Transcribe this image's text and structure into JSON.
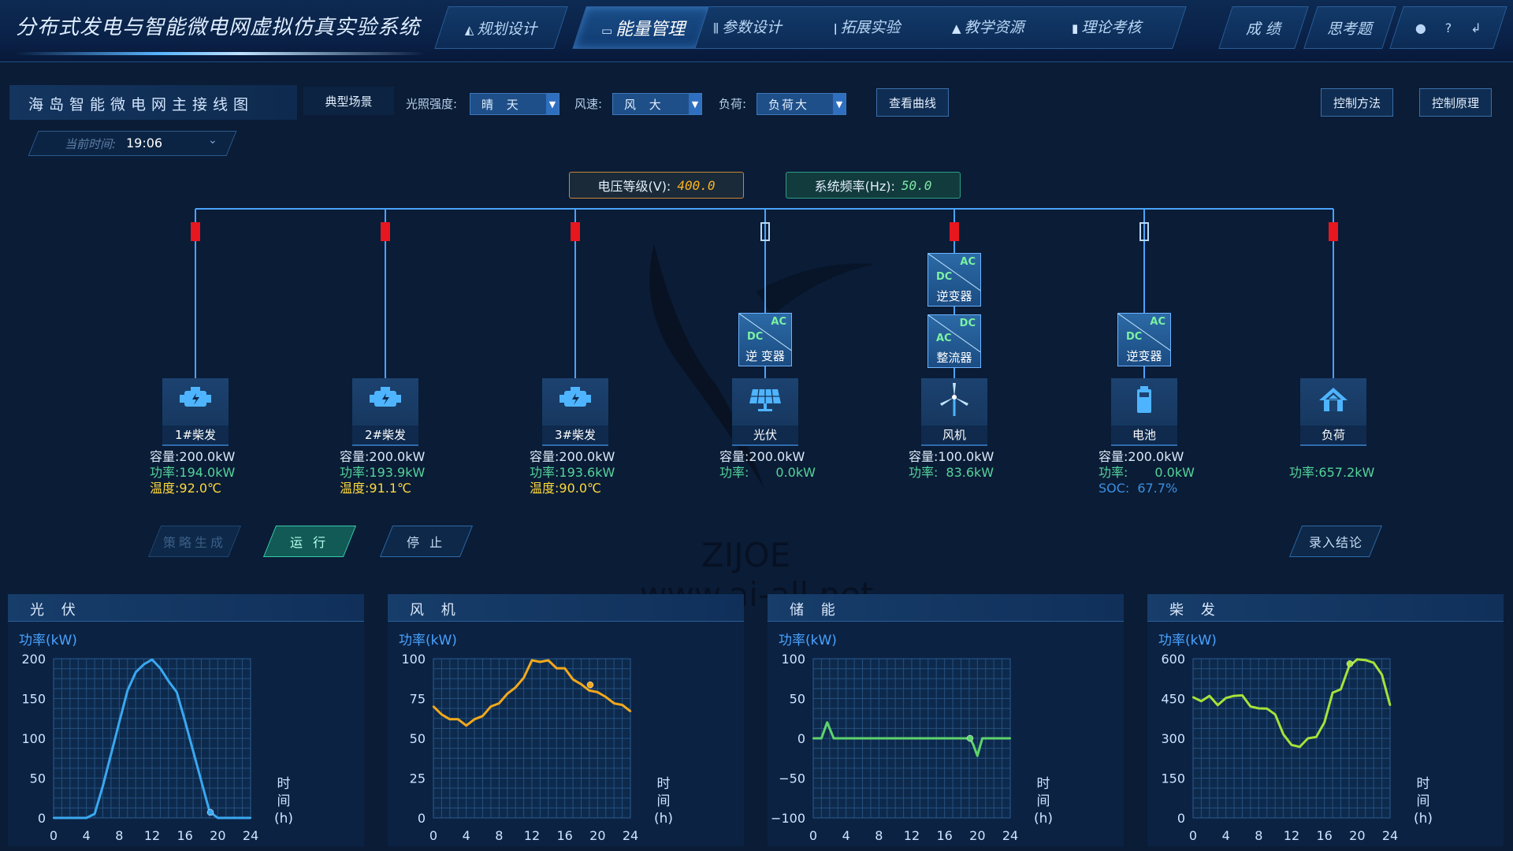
{
  "app": {
    "title": "分布式发电与智能微电网虚拟仿真实验系统"
  },
  "nav": {
    "tabs": [
      {
        "label": "规划设计",
        "icon": "pencil-triangle-icon",
        "active": false
      },
      {
        "label": "能量管理",
        "icon": "monitor-chart-icon",
        "active": true
      },
      {
        "label": "参数设计",
        "icon": "sliders-icon",
        "active": false
      },
      {
        "label": "拓展实验",
        "icon": "test-tube-icon",
        "active": false
      },
      {
        "label": "教学资源",
        "icon": "graduation-cap-icon",
        "active": false
      },
      {
        "label": "理论考核",
        "icon": "bar-chart-icon",
        "active": false
      }
    ],
    "right": [
      {
        "label": "成 绩"
      },
      {
        "label": "思考题"
      }
    ],
    "icons": [
      "user-icon",
      "help-icon",
      "exit-icon"
    ],
    "icon_glyphs": {
      "user": "●",
      "help": "?",
      "exit": "↲"
    }
  },
  "toolbar": {
    "panel_title": "海岛智能微电网主接线图",
    "scenario_button": "典型场景",
    "light_label": "光照强度:",
    "light_value": "晴 天",
    "wind_label": "风速:",
    "wind_value": "风 大",
    "load_label": "负荷:",
    "load_value": "负荷大",
    "view_curve": "查看曲线",
    "control_method": "控制方法",
    "control_principle": "控制原理",
    "time_label": "当前时间:",
    "time_value": "19:06"
  },
  "readouts": {
    "voltage_label": "电压等级(V):",
    "voltage_value": "400.0",
    "freq_label": "系统频率(Hz):",
    "freq_value": "50.0"
  },
  "converters": {
    "inverter": "逆变器",
    "inverter_spaced": "逆 变器",
    "rectifier": "整流器",
    "ac": "AC",
    "dc": "DC"
  },
  "devices": [
    {
      "name": "1#柴发",
      "icon": "diesel-engine-icon",
      "breaker": "closed",
      "lines": [
        {
          "k": "容量:",
          "v": "200.0kW",
          "cls": "c"
        },
        {
          "k": "功率:",
          "v": "194.0kW",
          "cls": "p"
        },
        {
          "k": "温度:",
          "v": "92.0℃",
          "cls": "t"
        }
      ]
    },
    {
      "name": "2#柴发",
      "icon": "diesel-engine-icon",
      "breaker": "closed",
      "lines": [
        {
          "k": "容量:",
          "v": "200.0kW",
          "cls": "c"
        },
        {
          "k": "功率:",
          "v": "193.9kW",
          "cls": "p"
        },
        {
          "k": "温度:",
          "v": "91.1℃",
          "cls": "t"
        }
      ]
    },
    {
      "name": "3#柴发",
      "icon": "diesel-engine-icon",
      "breaker": "closed",
      "lines": [
        {
          "k": "容量:",
          "v": "200.0kW",
          "cls": "c"
        },
        {
          "k": "功率:",
          "v": "193.6kW",
          "cls": "p"
        },
        {
          "k": "温度:",
          "v": "90.0℃",
          "cls": "t"
        }
      ]
    },
    {
      "name": "光伏",
      "icon": "solar-panel-icon",
      "breaker": "open",
      "lines": [
        {
          "k": "容量:",
          "v": "200.0kW",
          "cls": "c"
        },
        {
          "k": "功率:",
          "v": "0.0kW",
          "cls": "p"
        }
      ]
    },
    {
      "name": "风机",
      "icon": "wind-turbine-icon",
      "breaker": "closed",
      "lines": [
        {
          "k": "容量:",
          "v": "100.0kW",
          "cls": "c"
        },
        {
          "k": "功率:",
          "v": "83.6kW",
          "cls": "p"
        }
      ]
    },
    {
      "name": "电池",
      "icon": "battery-icon",
      "breaker": "open",
      "lines": [
        {
          "k": "容量:",
          "v": "200.0kW",
          "cls": "c"
        },
        {
          "k": "功率:",
          "v": "0.0kW",
          "cls": "p"
        },
        {
          "k": "SOC:",
          "v": "67.7%",
          "cls": "s"
        }
      ]
    },
    {
      "name": "负荷",
      "icon": "house-icon",
      "breaker": "closed",
      "lines": [
        {
          "k": "功率:",
          "v": "657.2kW",
          "cls": "p"
        }
      ]
    }
  ],
  "actions": {
    "strategy": "策略生成",
    "run": "运 行",
    "stop": "停 止",
    "conclusion": "录入结论"
  },
  "watermark": {
    "line1": "ZIJOE",
    "line2": "www.ai-all.net"
  },
  "colors": {
    "breaker_closed": "#e8161e",
    "pv": "#3aa8f0",
    "wind": "#f2a81c",
    "storage": "#5ed46c",
    "diesel": "#a6e23a",
    "bus": "#4aa3ff"
  },
  "chart_data": [
    {
      "type": "line",
      "title": "光 伏",
      "ylabel": "功率(kW)",
      "xlabel": "时间(h)",
      "xlim": [
        0,
        24
      ],
      "ylim": [
        0,
        200
      ],
      "yticks": [
        0,
        50,
        100,
        150,
        200
      ],
      "xticks": [
        0,
        4,
        8,
        12,
        16,
        20,
        24
      ],
      "color": "#3aa8f0",
      "x": [
        0,
        1,
        2,
        3,
        4,
        5,
        6,
        7,
        8,
        9,
        10,
        11,
        12,
        13,
        14,
        15,
        16,
        17,
        18,
        19,
        20,
        21,
        22,
        23,
        24
      ],
      "y": [
        0,
        0,
        0,
        0,
        0,
        5,
        40,
        80,
        120,
        160,
        183,
        193,
        199,
        188,
        172,
        158,
        122,
        84,
        46,
        8,
        0,
        0,
        0,
        0,
        0
      ],
      "marker": {
        "x": 19.1,
        "y": 7
      }
    },
    {
      "type": "line",
      "title": "风 机",
      "ylabel": "功率(kW)",
      "xlabel": "时间(h)",
      "xlim": [
        0,
        24
      ],
      "ylim": [
        0,
        100
      ],
      "yticks": [
        0,
        25,
        50,
        75,
        100
      ],
      "xticks": [
        0,
        4,
        8,
        12,
        16,
        20,
        24
      ],
      "color": "#f2a81c",
      "x": [
        0,
        1,
        2,
        3,
        4,
        5,
        6,
        7,
        8,
        9,
        10,
        11,
        12,
        13,
        14,
        15,
        16,
        17,
        18,
        19,
        20,
        21,
        22,
        23,
        24
      ],
      "y": [
        70,
        65,
        62,
        62,
        58,
        62,
        64,
        70,
        72,
        78,
        82,
        88,
        99,
        98,
        99,
        94,
        94,
        87,
        84,
        80,
        79,
        76,
        72,
        71,
        67
      ],
      "marker": {
        "x": 19.1,
        "y": 83.6
      }
    },
    {
      "type": "line",
      "title": "储 能",
      "ylabel": "功率(kW)",
      "xlabel": "时间(h)",
      "xlim": [
        0,
        24
      ],
      "ylim": [
        -100,
        100
      ],
      "yticks": [
        -100,
        -50,
        0,
        50,
        100
      ],
      "xticks": [
        0,
        4,
        8,
        12,
        16,
        20,
        24
      ],
      "color": "#5ed46c",
      "x": [
        0,
        1,
        1.7,
        2.5,
        3,
        4,
        8,
        12,
        16,
        18,
        19.1,
        19.5,
        20,
        20.6,
        21,
        22,
        23,
        24
      ],
      "y": [
        0,
        0,
        20,
        0,
        0,
        0,
        0,
        0,
        0,
        0,
        0,
        -8,
        -22,
        0,
        0,
        0,
        0,
        0
      ],
      "marker": {
        "x": 19.1,
        "y": 0
      }
    },
    {
      "type": "line",
      "title": "柴 发",
      "ylabel": "功率(kW)",
      "xlabel": "时间(h)",
      "xlim": [
        0,
        24
      ],
      "ylim": [
        0,
        600
      ],
      "yticks": [
        0,
        150,
        300,
        450,
        600
      ],
      "xticks": [
        0,
        4,
        8,
        12,
        16,
        20,
        24
      ],
      "color": "#a6e23a",
      "x": [
        0,
        1,
        2,
        3,
        4,
        5,
        6,
        7,
        8,
        9,
        10,
        11,
        12,
        13,
        14,
        15,
        16,
        17,
        18,
        19,
        20,
        21,
        22,
        23,
        24
      ],
      "y": [
        455,
        440,
        460,
        425,
        452,
        460,
        462,
        420,
        413,
        412,
        390,
        315,
        275,
        268,
        300,
        305,
        360,
        472,
        485,
        571,
        598,
        595,
        585,
        540,
        425
      ],
      "marker": {
        "x": 19.1,
        "y": 581
      }
    }
  ]
}
